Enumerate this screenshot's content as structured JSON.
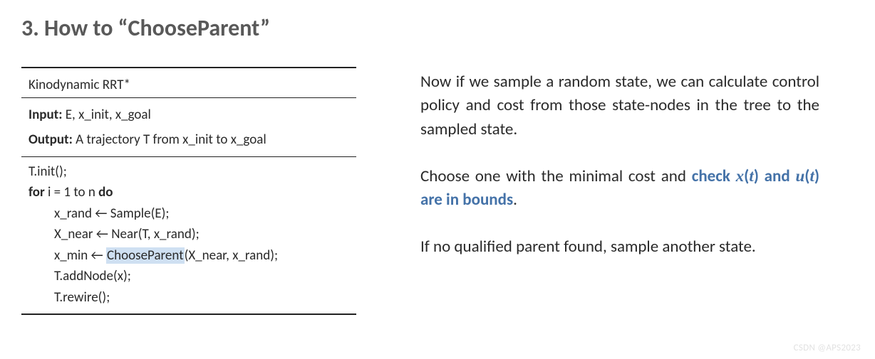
{
  "heading": "3. How to   “ChooseParent”",
  "algo": {
    "title": "Kinodynamic RRT*",
    "input_label": "Input:",
    "input_text": " E, x_init, x_goal",
    "output_label": "Output:",
    "output_text": " A trajectory T from x_init to x_goal",
    "line1": "T.init();",
    "line2_for": "for",
    "line2_mid": " i = 1 to n ",
    "line2_do": "do",
    "line3": "x_rand ← Sample(E);",
    "line4": "X_near ← Near(T, x_rand);",
    "line5_pre": "x_min ← ",
    "line5_hl": "ChooseParent",
    "line5_post": "(X_near, x_rand);",
    "line6": "T.addNode(x);",
    "line7": "T.rewire();"
  },
  "explain": {
    "p1": "Now if we sample a random state, we can calculate control policy and cost from those state-nodes in the tree to the sampled state.",
    "p2_pre": "Choose one with the minimal cost and ",
    "p2_hl_1": "check ",
    "p2_xt": "x",
    "p2_paren1a": "(",
    "p2_t1": "t",
    "p2_paren1b": ")",
    "p2_and": " and ",
    "p2_ut": "u",
    "p2_paren2a": "(",
    "p2_t2": "t",
    "p2_paren2b": ")",
    "p2_hl_2": " are in bounds",
    "p2_post": ".",
    "p3": "If no qualified parent found, sample another state."
  },
  "watermark": "CSDN @APS2023"
}
